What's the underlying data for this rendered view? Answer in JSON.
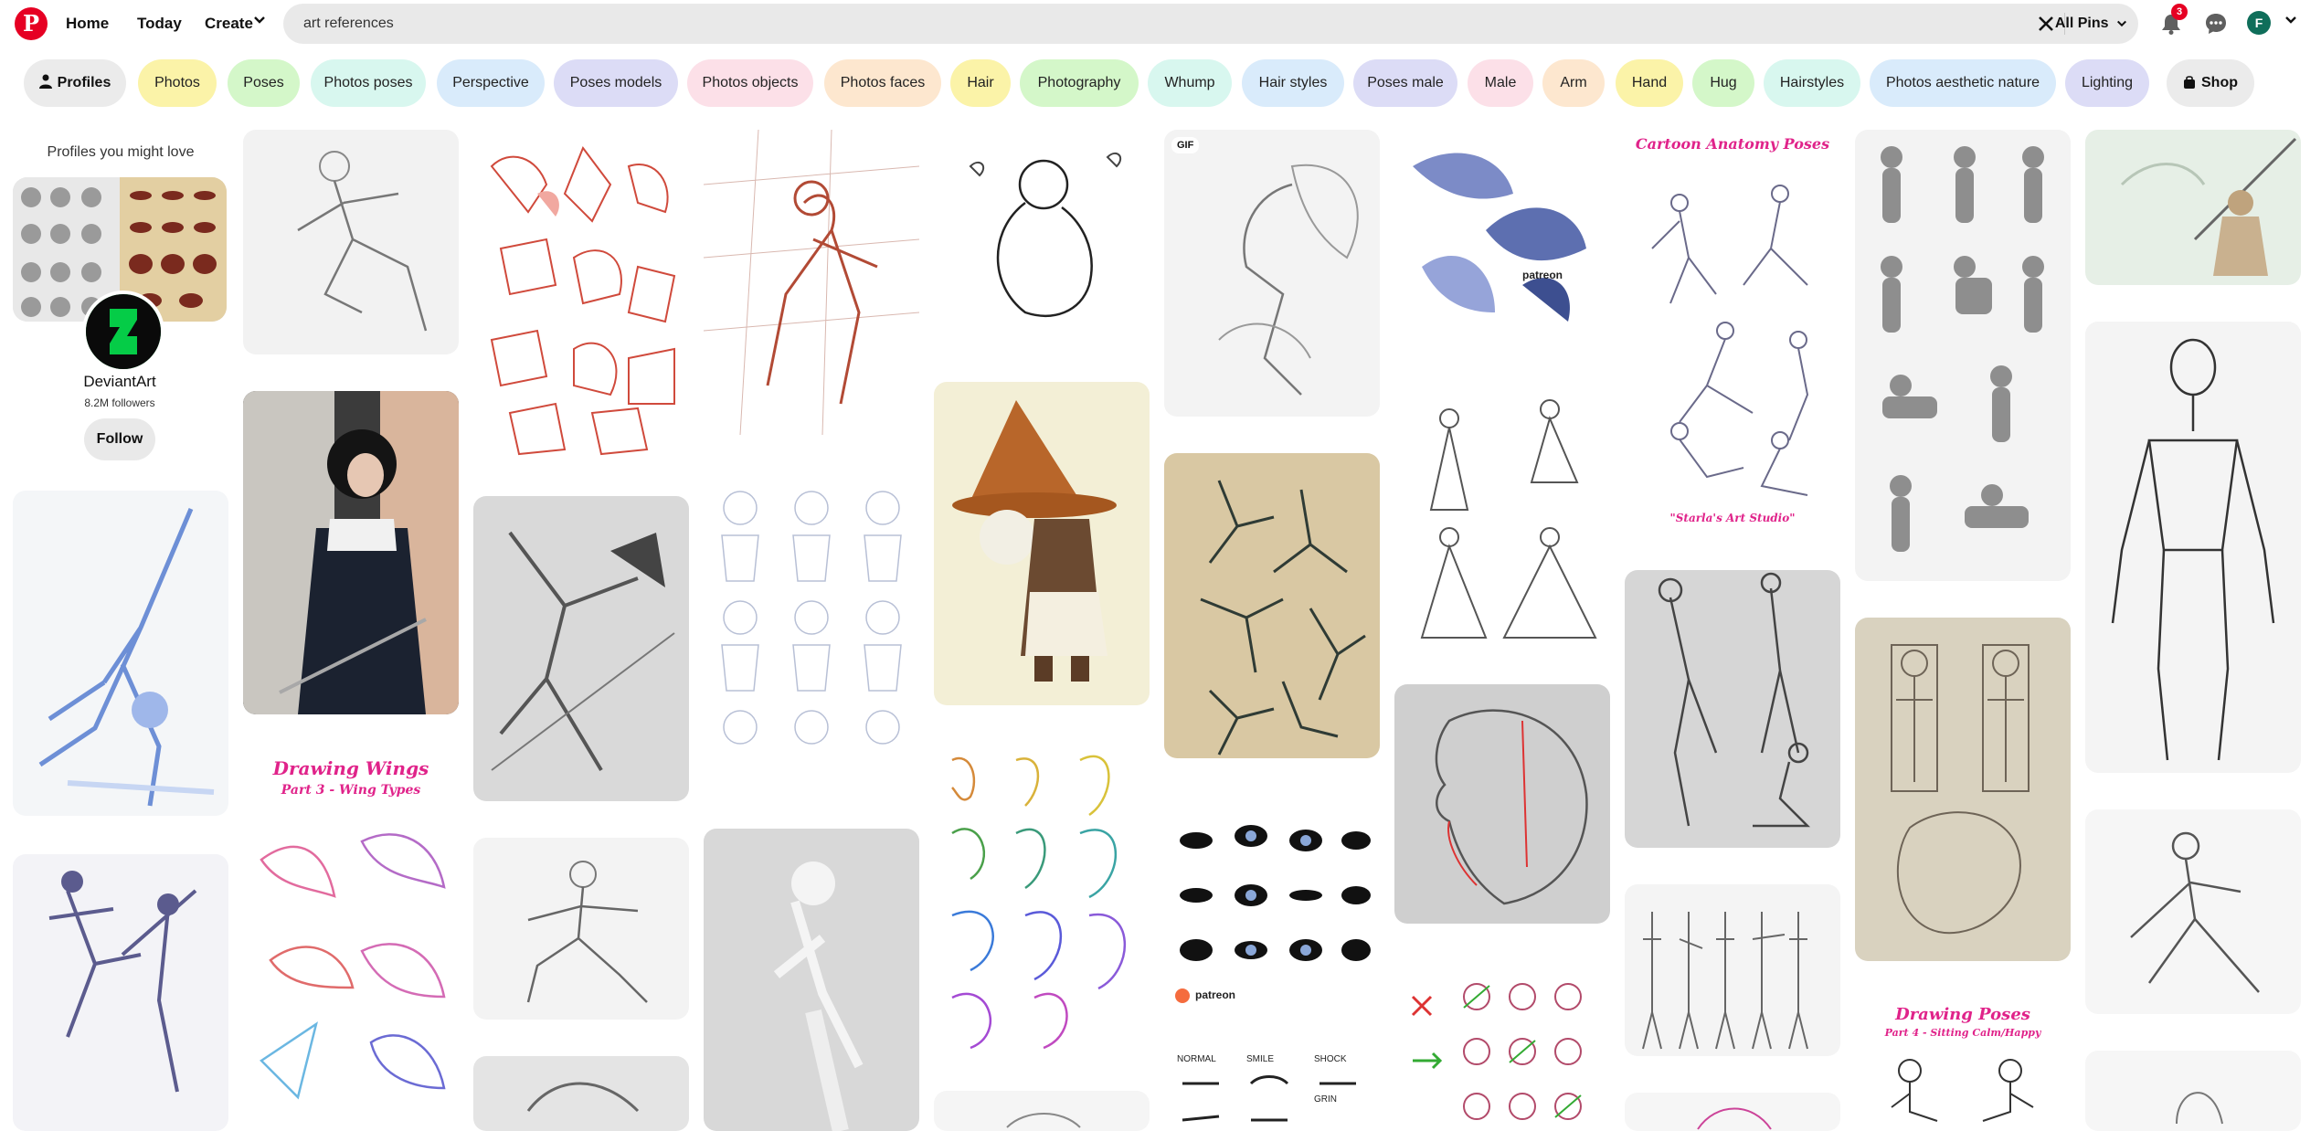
{
  "nav": {
    "home": "Home",
    "today": "Today",
    "create": "Create",
    "notification_count": "3",
    "avatar_initial": "F"
  },
  "search": {
    "value": "art references",
    "scope": "All Pins"
  },
  "chips": [
    {
      "label": "Profiles",
      "color": "#ebebeb"
    },
    {
      "label": "Photos",
      "color": "#fbf3a8"
    },
    {
      "label": "Poses",
      "color": "#d4f7c9"
    },
    {
      "label": "Photos poses",
      "color": "#d8f7ef"
    },
    {
      "label": "Perspective",
      "color": "#d9ebfb"
    },
    {
      "label": "Poses models",
      "color": "#dcdcf6"
    },
    {
      "label": "Photos objects",
      "color": "#fce0e8"
    },
    {
      "label": "Photos faces",
      "color": "#fde7cf"
    },
    {
      "label": "Hair",
      "color": "#fbf3a8"
    },
    {
      "label": "Photography",
      "color": "#d4f7c9"
    },
    {
      "label": "Whump",
      "color": "#d8f7ef"
    },
    {
      "label": "Hair styles",
      "color": "#d9ebfb"
    },
    {
      "label": "Poses male",
      "color": "#dcdcf6"
    },
    {
      "label": "Male",
      "color": "#fce0e8"
    },
    {
      "label": "Arm",
      "color": "#fde7cf"
    },
    {
      "label": "Hand",
      "color": "#fbf3a8"
    },
    {
      "label": "Hug",
      "color": "#d4f7c9"
    },
    {
      "label": "Hairstyles",
      "color": "#d8f7ef"
    },
    {
      "label": "Photos aesthetic nature",
      "color": "#d9ebfb"
    },
    {
      "label": "Lighting",
      "color": "#dcdcf6"
    },
    {
      "label": "Shop",
      "color": "#ebebeb"
    }
  ],
  "profile_card": {
    "heading": "Profiles you might love",
    "name": "DeviantArt",
    "followers": "8.2M followers",
    "follow_label": "Follow"
  },
  "pins": {
    "gif_badge": "GIF",
    "wings_title": "Drawing Wings",
    "wings_subtitle": "Part 3 - Wing Types",
    "cartoon_title": "Cartoon Anatomy Poses",
    "cartoon_footer": "\"Starla's Art Studio\"",
    "poses_title": "Drawing Poses",
    "poses_subtitle": "Part 4 - Sitting Calm/Happy",
    "patreon": "patreon",
    "expr_labels": [
      "NORMAL",
      "SMILE",
      "SHOCK",
      "GRIN"
    ]
  }
}
